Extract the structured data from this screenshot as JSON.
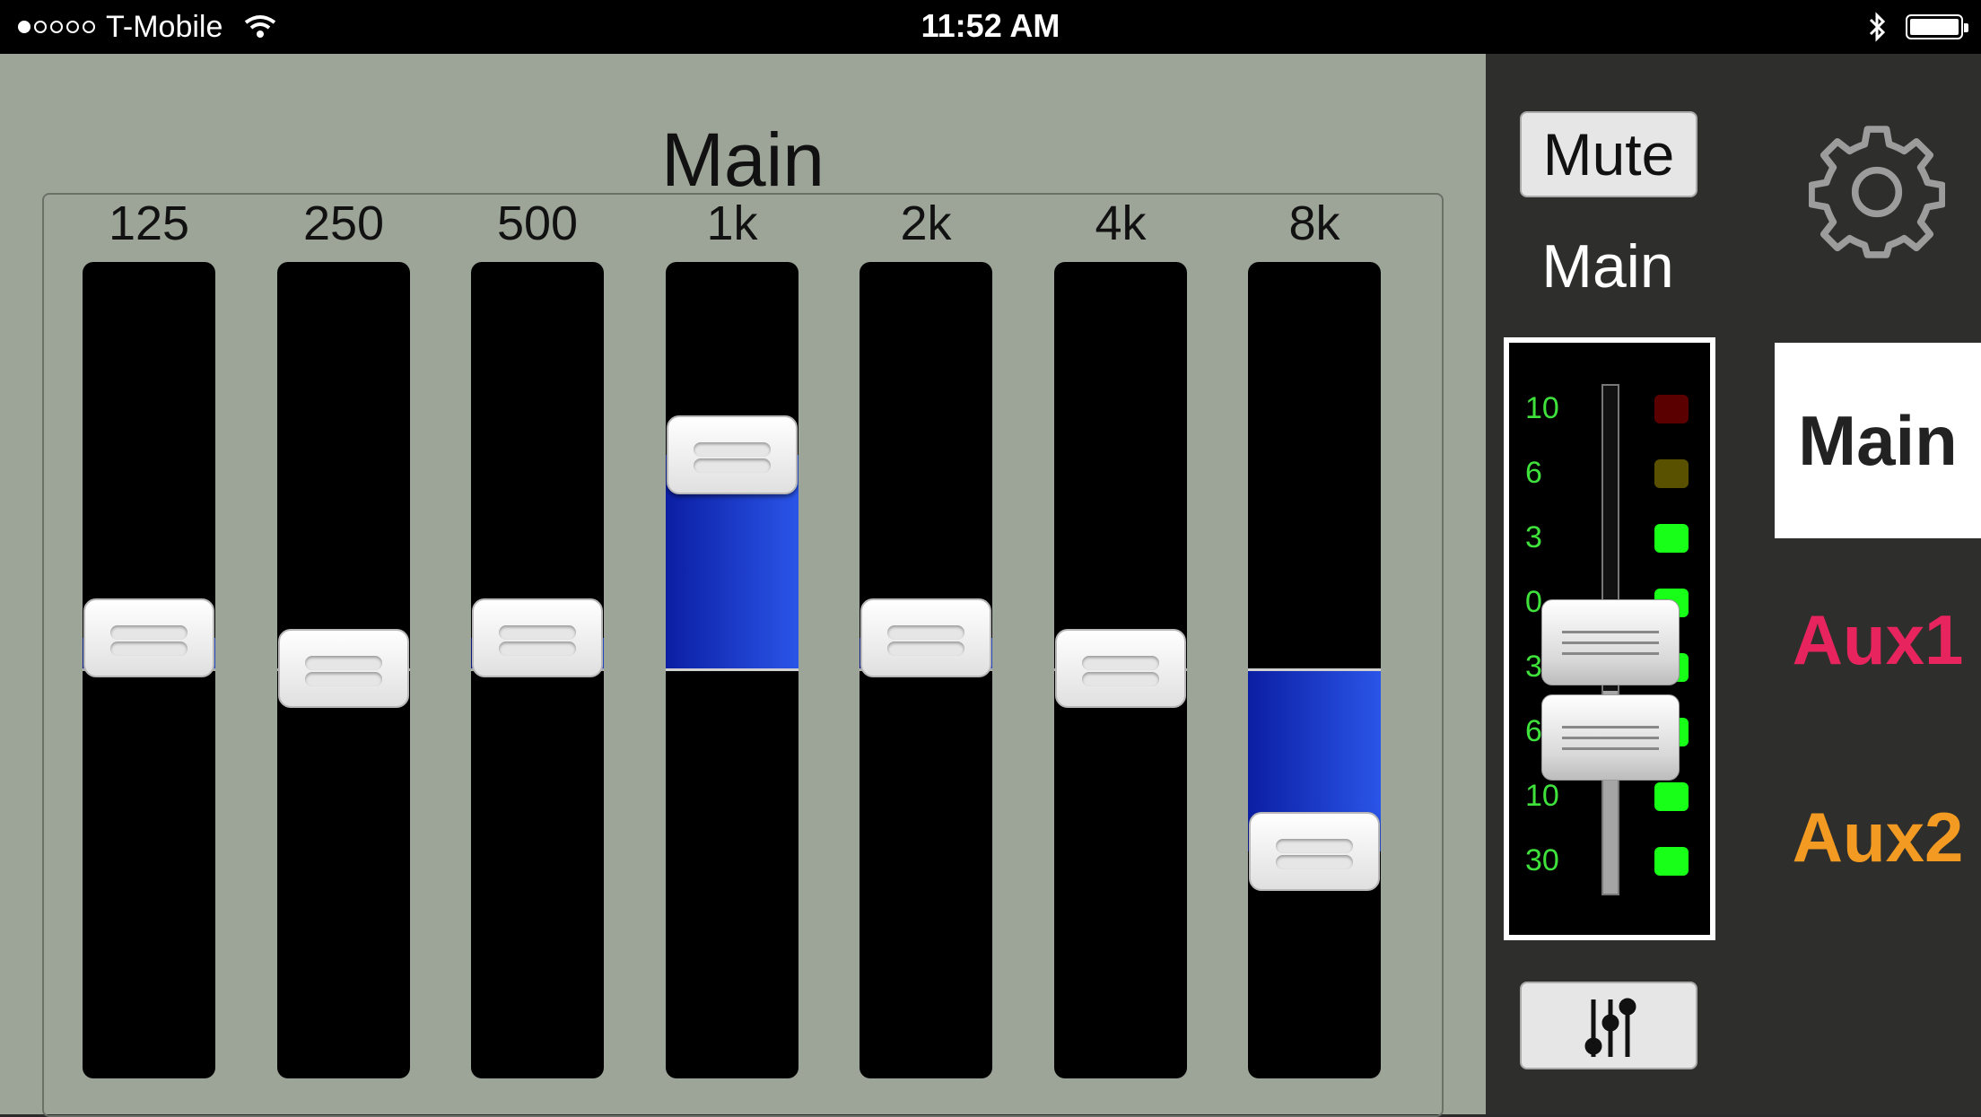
{
  "status_bar": {
    "carrier": "T-Mobile",
    "time": "11:52 AM"
  },
  "eq": {
    "title": "Main",
    "bands": [
      {
        "label": "125",
        "level": 0.5
      },
      {
        "label": "250",
        "level": 0.0
      },
      {
        "label": "500",
        "level": 0.5
      },
      {
        "label": "1k",
        "level": 3.5
      },
      {
        "label": "2k",
        "level": 0.5
      },
      {
        "label": "4k",
        "level": 0.0
      },
      {
        "label": "8k",
        "level": -3.0
      }
    ]
  },
  "channel": {
    "mute_label": "Mute",
    "name": "Main",
    "meter_scale": [
      "10",
      "6",
      "3",
      "0",
      "3",
      "6",
      "10",
      "30"
    ],
    "led_colors": [
      "#5a0000",
      "#5a5100",
      "#18ff18",
      "#18ff18",
      "#18ff18",
      "#18ff18",
      "#18ff18",
      "#18ff18"
    ]
  },
  "icons": {
    "settings": "gear-icon",
    "mixer": "sliders-icon",
    "wifi": "wifi-icon",
    "bluetooth": "bluetooth-icon",
    "battery": "battery-icon"
  },
  "tabs": [
    {
      "label": "Main",
      "color": "#222222",
      "active": true
    },
    {
      "label": "Aux1",
      "color": "#e8245e",
      "active": false
    },
    {
      "label": "Aux2",
      "color": "#f39a22",
      "active": false
    }
  ]
}
